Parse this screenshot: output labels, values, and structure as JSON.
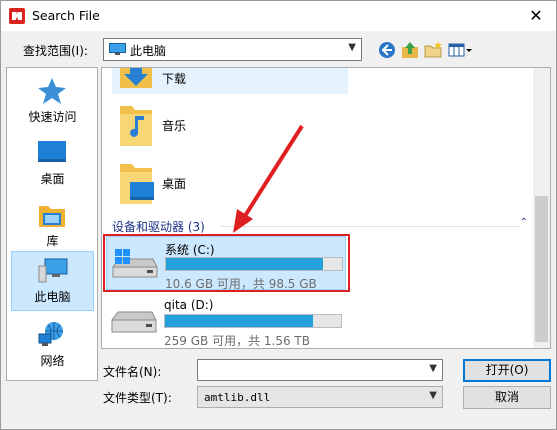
{
  "window": {
    "title": "Search File",
    "close_glyph": "✕"
  },
  "look_in": {
    "label": "查找范围(I):",
    "value": "此电脑"
  },
  "toolbar": {
    "icons": [
      "back-icon",
      "up-folder-icon",
      "new-folder-icon",
      "view-menu-icon"
    ]
  },
  "places": [
    {
      "label": "快速访问",
      "icon": "star-icon"
    },
    {
      "label": "桌面",
      "icon": "desktop-icon"
    },
    {
      "label": "库",
      "icon": "library-icon"
    },
    {
      "label": "此电脑",
      "icon": "this-pc-icon",
      "selected": true
    },
    {
      "label": "网络",
      "icon": "network-icon"
    }
  ],
  "folders": [
    {
      "name": "下载",
      "icon": "downloads-folder-icon"
    },
    {
      "name": "音乐",
      "icon": "music-folder-icon"
    },
    {
      "name": "桌面",
      "icon": "desktop-folder-icon"
    }
  ],
  "group": {
    "header": "设备和驱动器 (3)",
    "chevron": "⌃"
  },
  "drives": [
    {
      "name": "系统 (C:)",
      "info": "10.6 GB 可用，共 98.5 GB",
      "used_fraction": 0.89,
      "selected": true
    },
    {
      "name": "qita (D:)",
      "info": "259 GB 可用，共 1.56 TB",
      "used_fraction": 0.84,
      "selected": false
    }
  ],
  "filename": {
    "label": "文件名(N):",
    "value": ""
  },
  "filetype": {
    "label": "文件类型(T):",
    "value": "amtlib.dll"
  },
  "buttons": {
    "open": "打开(O)",
    "cancel": "取消"
  },
  "colors": {
    "accent": "#26a0da",
    "selection": "#cce8ff",
    "annotation_red": "#e02020"
  }
}
